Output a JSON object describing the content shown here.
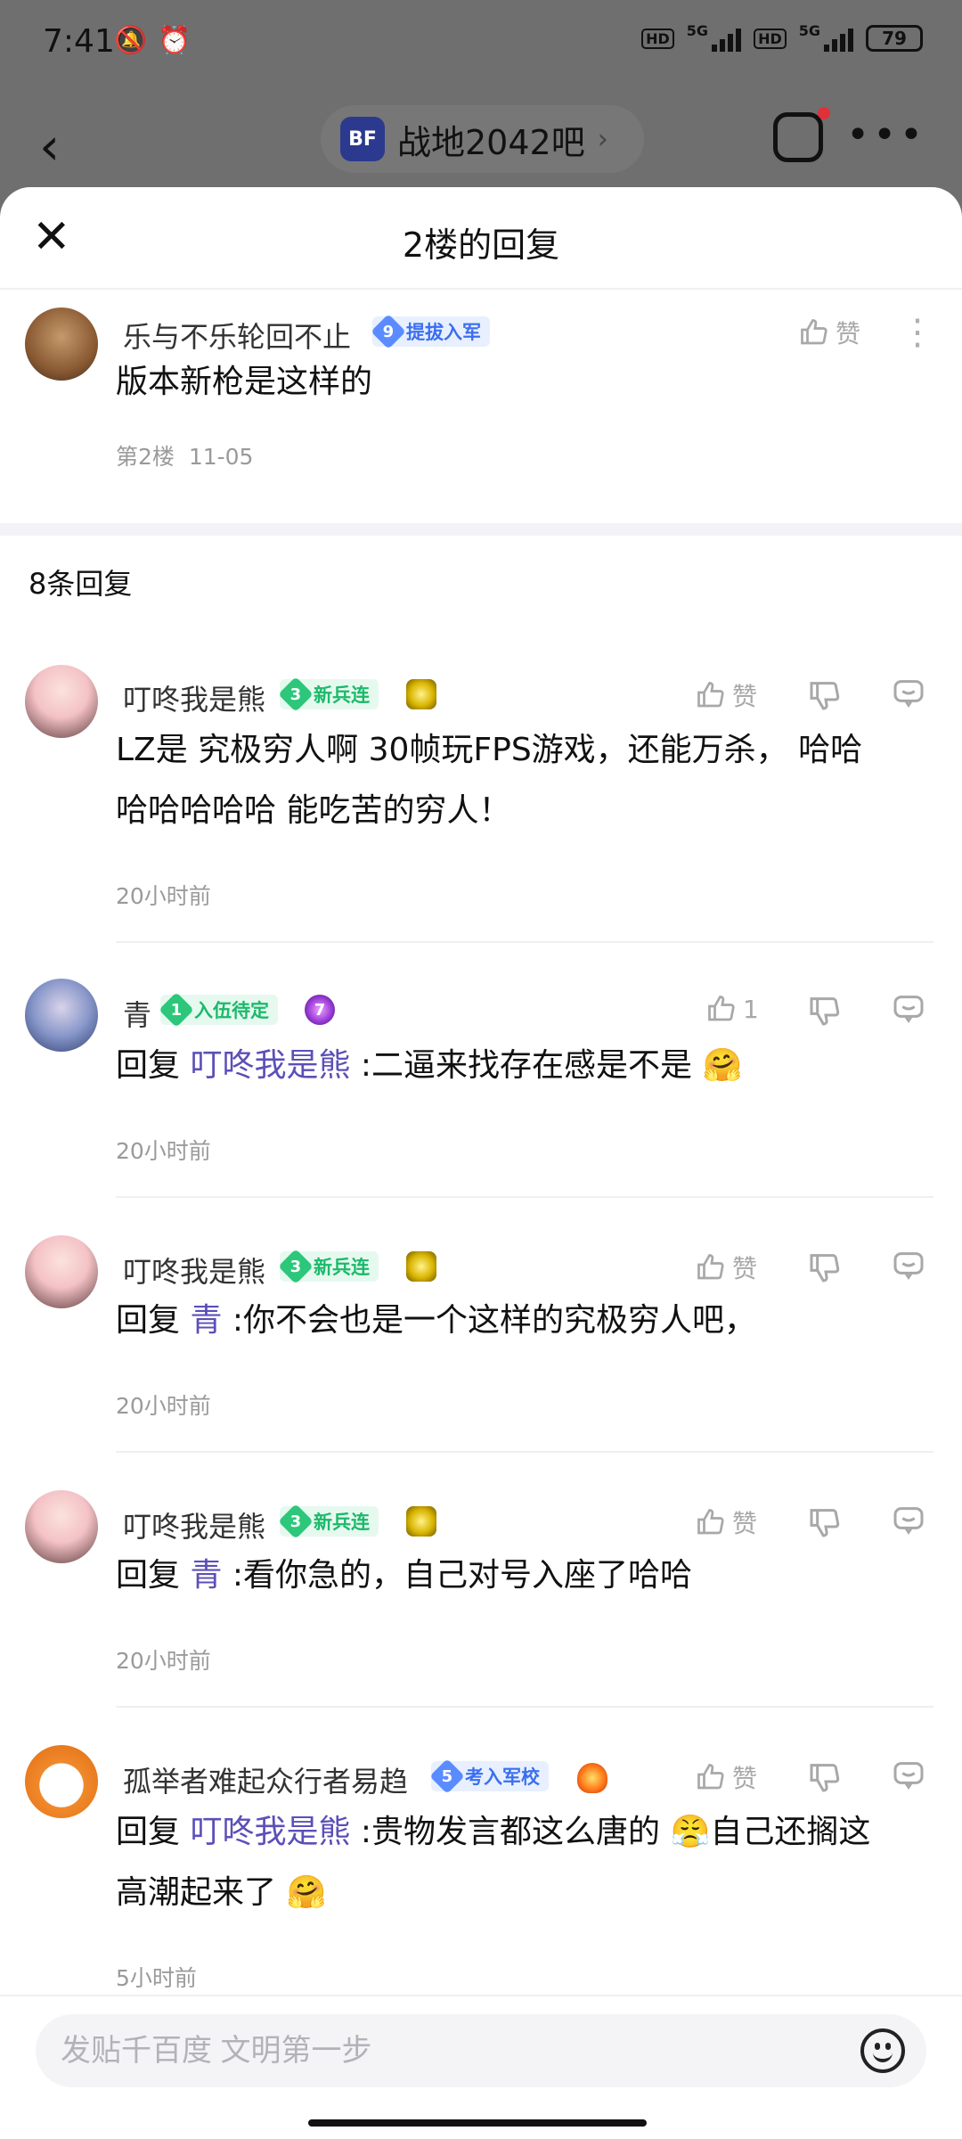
{
  "status": {
    "time": "7:41",
    "battery": "79",
    "net1": "5G",
    "net2": "5G",
    "hd": "HD"
  },
  "nav": {
    "forum_logo": "BF",
    "forum_name": "战地2042吧",
    "forum_arrow": "›"
  },
  "sheet": {
    "title": "2楼的回复"
  },
  "op": {
    "username": "乐与不乐轮回不止",
    "badge_level": "9",
    "badge_title": "提拔入军",
    "like_label": "赞",
    "content": "版本新枪是这样的",
    "floor": "第2楼",
    "date": "11-05"
  },
  "reply_count": "8条回复",
  "replies": [
    {
      "username": "叮咚我是熊",
      "badge_level": "3",
      "badge_title": "新兵连",
      "like": "赞",
      "line1": "LZ是 究极穷人啊 30帧玩FPS游戏，还能万杀，  哈哈",
      "line2": "哈哈哈哈哈 能吃苦的穷人！",
      "time": "20小时前"
    },
    {
      "username": "青",
      "badge_level": "1",
      "badge_title": "入伍待定",
      "medal": "7",
      "like": "1",
      "prefix": "回复 ",
      "at": "叮咚我是熊",
      "text": " :二逼来找存在感是不是 ",
      "emoji": "🤗",
      "time": "20小时前"
    },
    {
      "username": "叮咚我是熊",
      "badge_level": "3",
      "badge_title": "新兵连",
      "like": "赞",
      "prefix": "回复 ",
      "at": "青",
      "text": " :你不会也是一个这样的究极穷人吧，",
      "time": "20小时前"
    },
    {
      "username": "叮咚我是熊",
      "badge_level": "3",
      "badge_title": "新兵连",
      "like": "赞",
      "prefix": "回复 ",
      "at": "青",
      "text": " :看你急的，自己对号入座了哈哈",
      "time": "20小时前"
    },
    {
      "username": "孤举者难起众行者易趋",
      "badge_level": "5",
      "badge_title": "考入军校",
      "like": "赞",
      "prefix": "回复 ",
      "at": "叮咚我是熊",
      "text": " :贵物发言都这么唐的 ",
      "emoji1": "😤",
      "text2": "自己还搁这",
      "line2": "高潮起来了 ",
      "emoji2": "🤗",
      "time": "5小时前"
    }
  ],
  "input": {
    "placeholder": "发贴千百度 文明第一步"
  }
}
